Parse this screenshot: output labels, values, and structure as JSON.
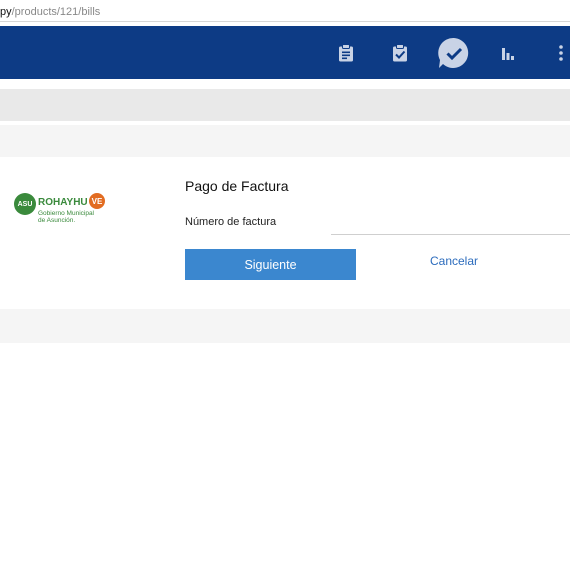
{
  "browser": {
    "url_host": "py",
    "url_path": "/products/121/bills"
  },
  "nav": {
    "icons": [
      "clipboard-icon",
      "clipboard-check-icon",
      "check-bubble-icon",
      "bar-chart-icon",
      "more-vertical-icon"
    ],
    "active_icon": "check-bubble-icon",
    "background_color": "#0d3b85"
  },
  "logo": {
    "badge": "ASU",
    "word": "ROHAYHU",
    "accent": "VE",
    "line1": "Gobierno Municipal",
    "line2": "de Asunción."
  },
  "form": {
    "title": "Pago de Factura",
    "field_label": "Número de factura",
    "field_value": "",
    "field_placeholder": "",
    "submit_label": "Siguiente",
    "cancel_label": "Cancelar",
    "submit_color": "#3b87cf",
    "cancel_color": "#2c6cbd"
  }
}
